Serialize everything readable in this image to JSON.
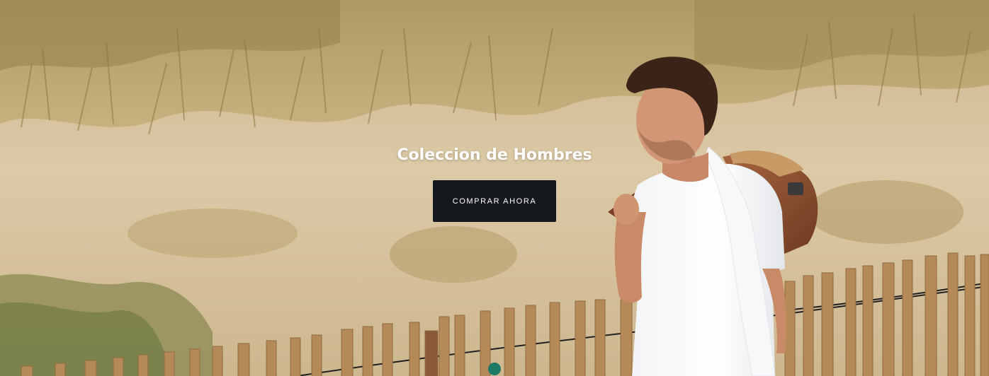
{
  "hero": {
    "title": "Coleccion de Hombres",
    "cta_label": "COMPRAR AHORA",
    "background_image": "man-walking-beach-dunes-photo"
  },
  "colors": {
    "button_bg": "#15181d",
    "title_text": "#ffffff",
    "sand": "#d9c6a2",
    "grass": "#b8a26c"
  }
}
